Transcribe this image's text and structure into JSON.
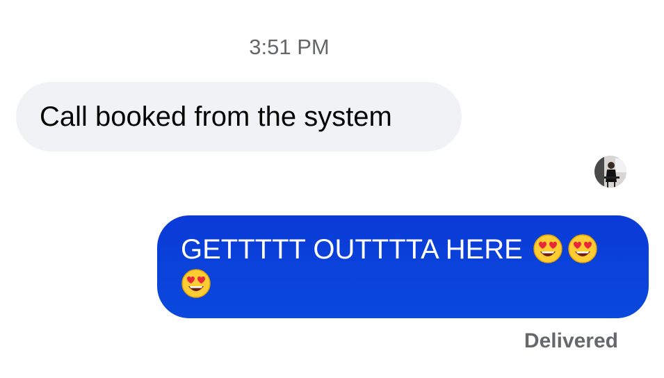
{
  "conversation": {
    "timestamp": "3:51 PM",
    "incoming": {
      "text": "Call booked from the system"
    },
    "outgoing": {
      "text": "GETTTTT OUTTTTA HERE",
      "emoji_icons": [
        "heart-eyes-emoji-icon",
        "heart-eyes-emoji-icon",
        "heart-eyes-emoji-icon"
      ],
      "bubble_color": "#0a40da",
      "status": "Delivered"
    },
    "read_receipt_avatar": "user-avatar-icon"
  }
}
